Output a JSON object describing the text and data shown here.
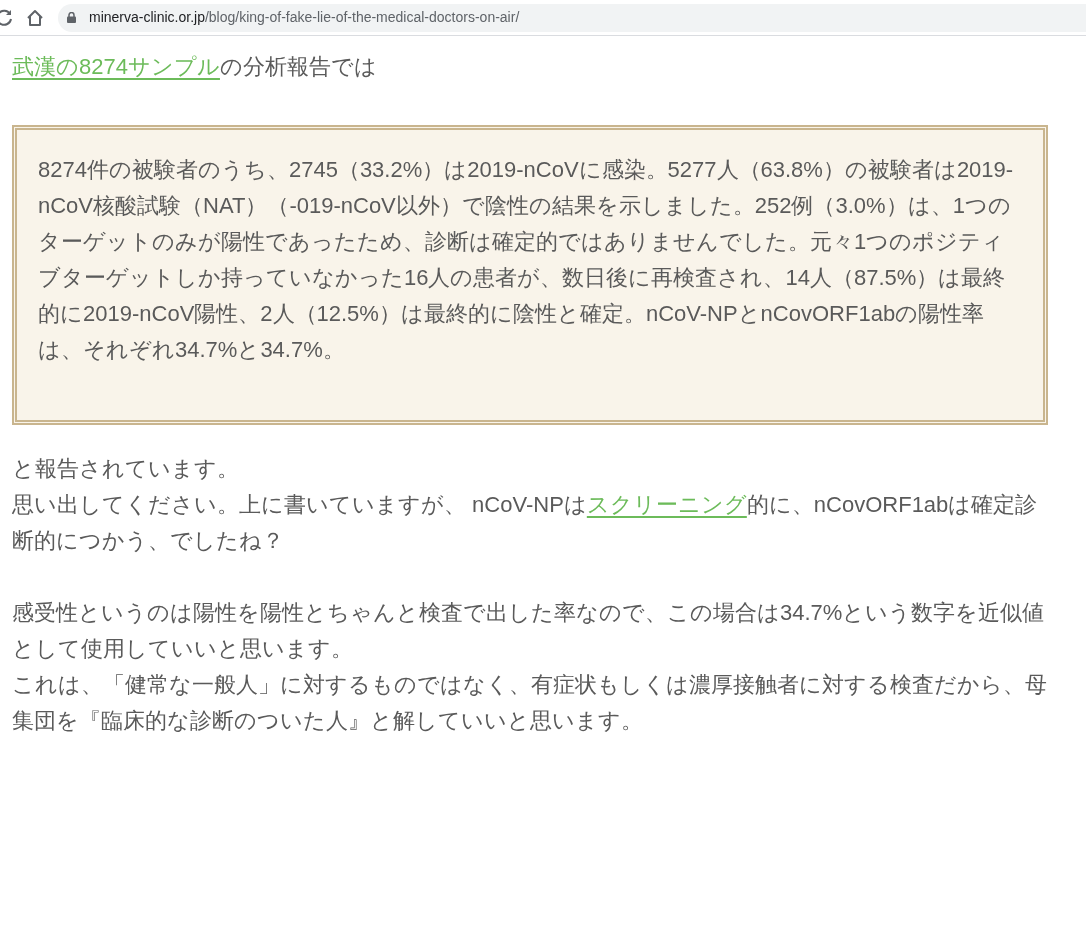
{
  "browser": {
    "url_domain": "minerva-clinic.or.jp",
    "url_path": "/blog/king-of-fake-lie-of-the-medical-doctors-on-air/"
  },
  "intro": [
    {
      "kind": "link",
      "text": "武漢の8274サンプル"
    },
    {
      "kind": "text",
      "text": "の分析報告では"
    }
  ],
  "quote": "8274件の被験者のうち、2745（33.2%）は2019-nCoVに感染。5277人（63.8%）の被験者は2019-nCoV核酸試験（NAT）（-019-nCoV以外）で陰性の結果を示しました。252例（3.0%）は、1つのターゲットのみが陽性であったため、診断は確定的ではありませんでした。元々1つのポジティブターゲットしか持っていなかった16人の患者が、数日後に再検査され、14人（87.5%）は最終的に2019-nCoV陽性、2人（12.5%）は最終的に陰性と確定。nCoV-NPとnCovORF1abの陽性率は、それぞれ34.7%と34.7%。",
  "followup": [
    [
      {
        "kind": "text",
        "text": "と報告されています。"
      }
    ],
    [
      {
        "kind": "text",
        "text": "思い出してください。上に書いていますが、 nCoV-NPは"
      },
      {
        "kind": "link",
        "text": "スクリーニング"
      },
      {
        "kind": "text",
        "text": "的に、nCovORF1abは確定診断的につかう、でしたね？"
      }
    ]
  ],
  "conclusion": [
    [
      {
        "kind": "text",
        "text": "感受性というのは陽性を陽性とちゃんと検査で出した率なので、この場合は34.7%という数字を近似値として使用していいと思います。"
      }
    ],
    [
      {
        "kind": "text",
        "text": "これは、「健常な一般人」に対するものではなく、有症状もしくは濃厚接触者に対する検査だから、母集団を『臨床的な診断のついた人』と解していいと思います。"
      }
    ]
  ]
}
